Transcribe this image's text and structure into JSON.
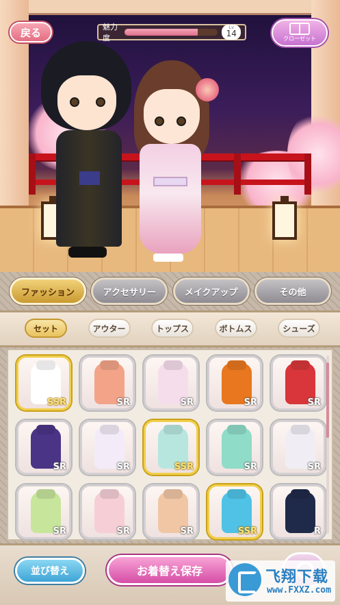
{
  "hud": {
    "back_label": "戻る",
    "charm_label": "魅力度",
    "charm_progress": 0.78,
    "level_caption": "Lv",
    "level": "14",
    "closet_label": "クローゼット"
  },
  "category_tabs": [
    {
      "label": "ファッション",
      "active": true
    },
    {
      "label": "アクセサリー",
      "active": false
    },
    {
      "label": "メイクアップ",
      "active": false
    },
    {
      "label": "その他",
      "active": false
    }
  ],
  "sub_tabs": [
    {
      "label": "セット",
      "active": true
    },
    {
      "label": "アウター",
      "active": false
    },
    {
      "label": "トップス",
      "active": false
    },
    {
      "label": "ボトムス",
      "active": false
    },
    {
      "label": "シューズ",
      "active": false
    }
  ],
  "items": [
    {
      "rank": "SSR",
      "color": "#ffffff"
    },
    {
      "rank": "SR",
      "color": "#f3a488"
    },
    {
      "rank": "SR",
      "color": "#f6ddec"
    },
    {
      "rank": "SR",
      "color": "#e8771f"
    },
    {
      "rank": "SR",
      "color": "#d8363a"
    },
    {
      "rank": "SR",
      "color": "#4a3486"
    },
    {
      "rank": "SR",
      "color": "#f3ecf8"
    },
    {
      "rank": "SSR",
      "color": "#b7e6df"
    },
    {
      "rank": "SR",
      "color": "#8fdcc8"
    },
    {
      "rank": "SR",
      "color": "#f0eef4"
    },
    {
      "rank": "SR",
      "color": "#c7e59b"
    },
    {
      "rank": "SR",
      "color": "#f6cfd6"
    },
    {
      "rank": "SR",
      "color": "#f0c6a5"
    },
    {
      "rank": "SSR",
      "color": "#4fc2e6"
    },
    {
      "rank": "R",
      "color": "#1f2a4a"
    }
  ],
  "bottom": {
    "sort_label": "並び替え",
    "save_label": "お着替え保存"
  },
  "watermark": {
    "brand": "飞翔下载",
    "url": "www.FXXZ.com"
  }
}
